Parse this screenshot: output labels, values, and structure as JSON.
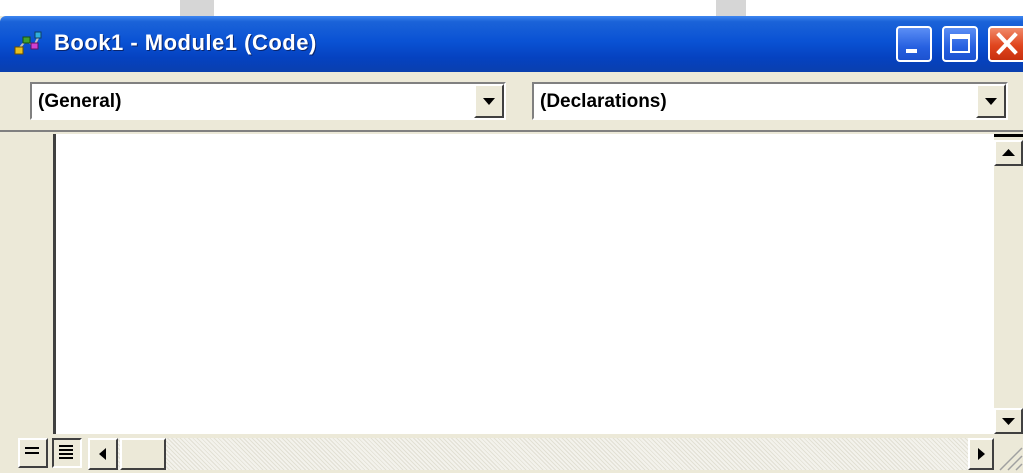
{
  "window": {
    "title": "Book1 - Module1 (Code)"
  },
  "toolbar": {
    "object_combo": "(General)",
    "procedure_combo": "(Declarations)"
  },
  "icons": {
    "app": "vba-project-icon",
    "minimize": "minimize-icon",
    "maximize": "maximize-icon",
    "close": "close-icon",
    "procedure_view": "procedure-view-icon",
    "full_module_view": "full-module-view-icon"
  },
  "colors": {
    "titlebar": "#0a52d4",
    "close_button": "#e0451e",
    "face": "#ece9d8"
  }
}
